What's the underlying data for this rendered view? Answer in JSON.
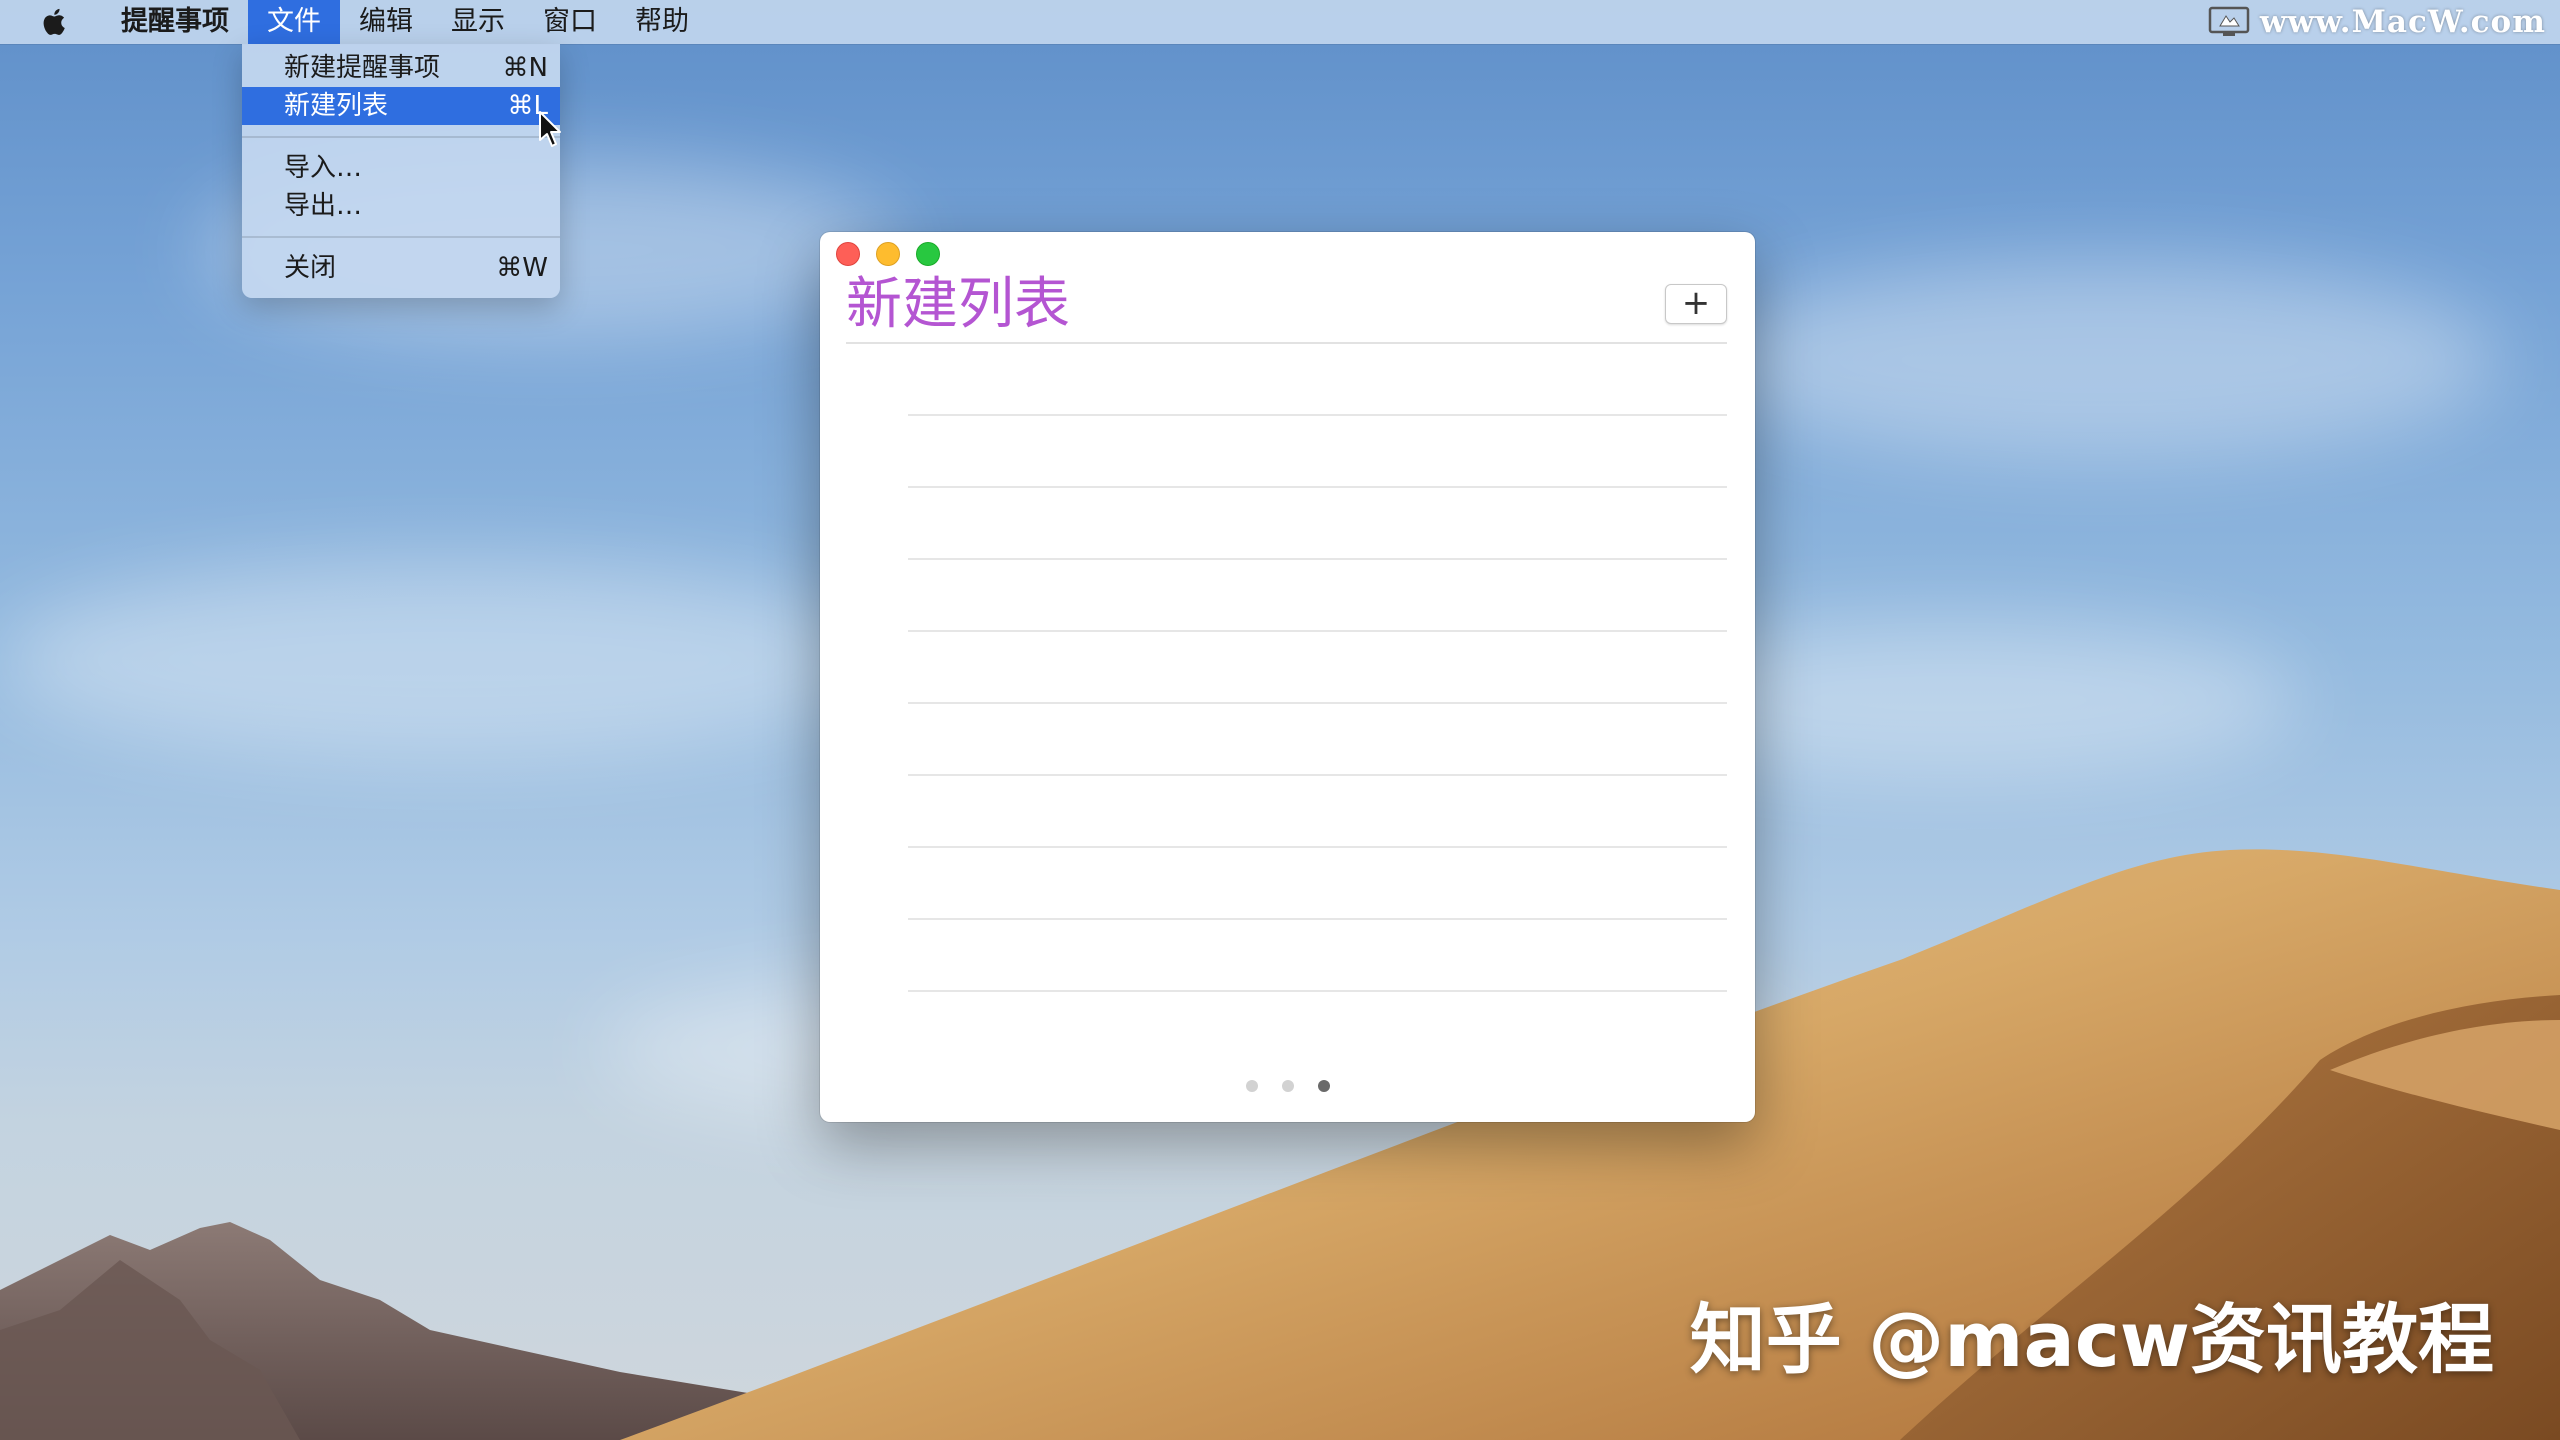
{
  "menubar": {
    "app_menu": "提醒事项",
    "menus": [
      "文件",
      "编辑",
      "显示",
      "窗口",
      "帮助"
    ],
    "active_menu": "文件",
    "watermark": "www.MacW.com"
  },
  "file_menu": {
    "items": [
      {
        "label": "新建提醒事项",
        "shortcut": "⌘N"
      },
      {
        "label": "新建列表",
        "shortcut": "⌘L",
        "highlighted": true
      },
      {
        "label": "导入…",
        "shortcut": ""
      },
      {
        "label": "导出…",
        "shortcut": ""
      },
      {
        "label": "关闭",
        "shortcut": "⌘W"
      }
    ]
  },
  "window": {
    "list_title": "新建列表",
    "add_button_label": "+",
    "title_color": "#b455d2",
    "empty_row_count": 9,
    "pager": {
      "pages": 3,
      "current": 3
    }
  },
  "watermark_bottom": "知乎 @macw资讯教程",
  "colors": {
    "menu_highlight": "#2f6ee0",
    "close": "#fe5f57",
    "minimize": "#febc2e",
    "zoom": "#28c840"
  }
}
